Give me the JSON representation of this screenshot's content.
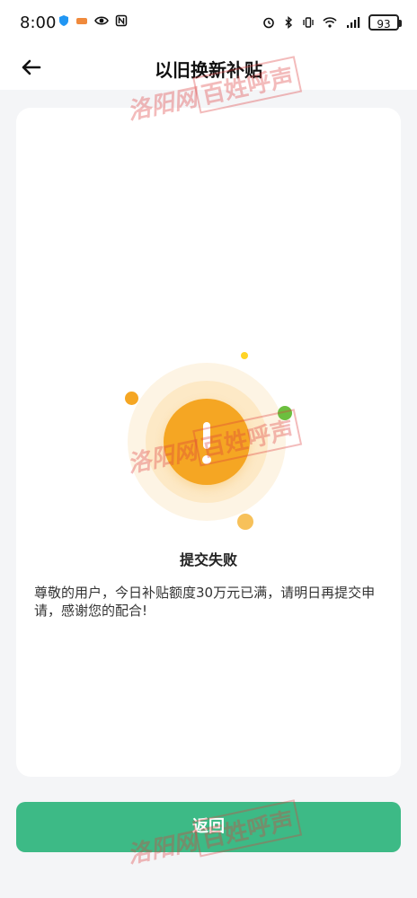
{
  "status_bar": {
    "time": "8:00",
    "battery": "93"
  },
  "nav": {
    "title": "以旧换新补贴"
  },
  "result": {
    "title": "提交失败",
    "message": "尊敬的用户，今日补贴额度30万元已满，请明日再提交申请，感谢您的配合!"
  },
  "actions": {
    "return_label": "返回"
  },
  "watermark": {
    "prefix": "洛阳网",
    "brand": "百姓呼声"
  },
  "colors": {
    "accent_green": "#3dba86",
    "alert_orange": "#f5a623"
  }
}
